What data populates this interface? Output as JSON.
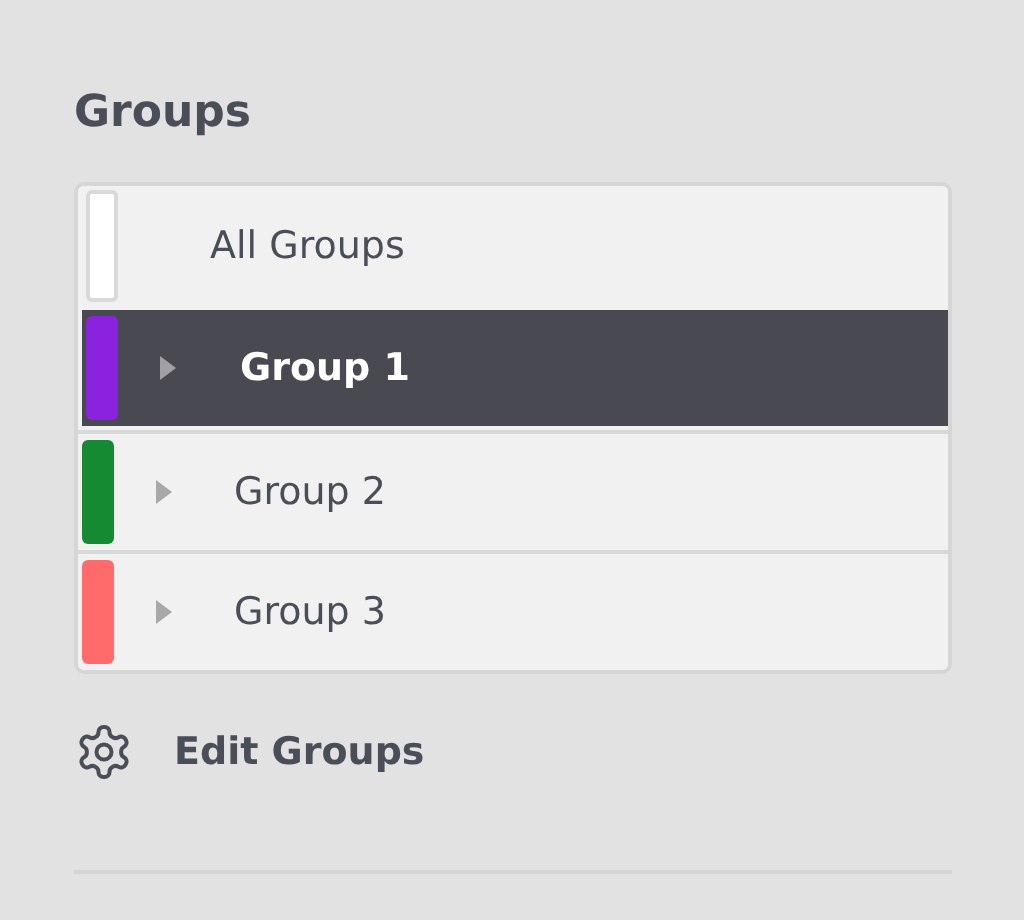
{
  "title": "Groups",
  "groups": [
    {
      "kind": "all",
      "label": "All Groups",
      "color": "#ffffff",
      "selected": false
    },
    {
      "kind": "group",
      "label": "Group 1",
      "color": "#8a22e0",
      "selected": true
    },
    {
      "kind": "group",
      "label": "Group 2",
      "color": "#168a32",
      "selected": false
    },
    {
      "kind": "group",
      "label": "Group 3",
      "color": "#ff6b6b",
      "selected": false
    }
  ],
  "edit_button": "Edit Groups"
}
